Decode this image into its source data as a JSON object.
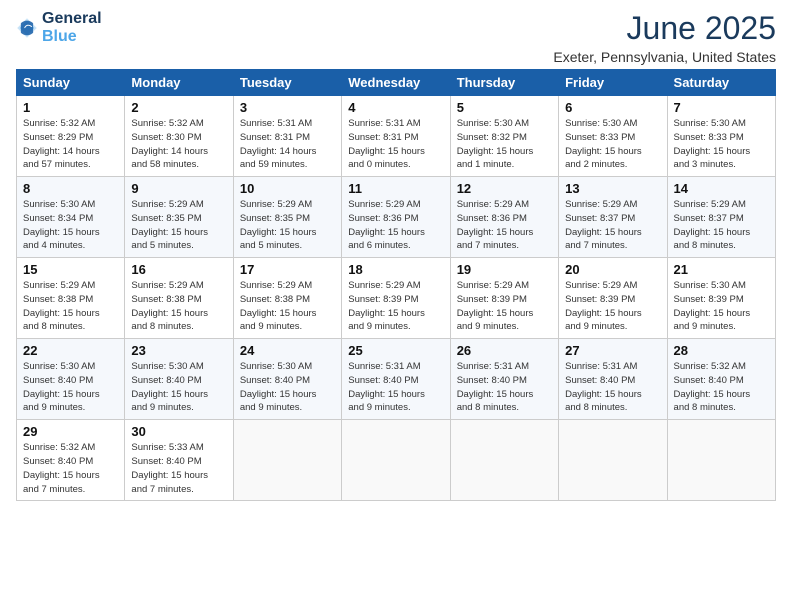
{
  "header": {
    "logo_line1": "General",
    "logo_line2": "Blue",
    "month": "June 2025",
    "location": "Exeter, Pennsylvania, United States"
  },
  "weekdays": [
    "Sunday",
    "Monday",
    "Tuesday",
    "Wednesday",
    "Thursday",
    "Friday",
    "Saturday"
  ],
  "weeks": [
    [
      {
        "day": "1",
        "info": "Sunrise: 5:32 AM\nSunset: 8:29 PM\nDaylight: 14 hours\nand 57 minutes."
      },
      {
        "day": "2",
        "info": "Sunrise: 5:32 AM\nSunset: 8:30 PM\nDaylight: 14 hours\nand 58 minutes."
      },
      {
        "day": "3",
        "info": "Sunrise: 5:31 AM\nSunset: 8:31 PM\nDaylight: 14 hours\nand 59 minutes."
      },
      {
        "day": "4",
        "info": "Sunrise: 5:31 AM\nSunset: 8:31 PM\nDaylight: 15 hours\nand 0 minutes."
      },
      {
        "day": "5",
        "info": "Sunrise: 5:30 AM\nSunset: 8:32 PM\nDaylight: 15 hours\nand 1 minute."
      },
      {
        "day": "6",
        "info": "Sunrise: 5:30 AM\nSunset: 8:33 PM\nDaylight: 15 hours\nand 2 minutes."
      },
      {
        "day": "7",
        "info": "Sunrise: 5:30 AM\nSunset: 8:33 PM\nDaylight: 15 hours\nand 3 minutes."
      }
    ],
    [
      {
        "day": "8",
        "info": "Sunrise: 5:30 AM\nSunset: 8:34 PM\nDaylight: 15 hours\nand 4 minutes."
      },
      {
        "day": "9",
        "info": "Sunrise: 5:29 AM\nSunset: 8:35 PM\nDaylight: 15 hours\nand 5 minutes."
      },
      {
        "day": "10",
        "info": "Sunrise: 5:29 AM\nSunset: 8:35 PM\nDaylight: 15 hours\nand 5 minutes."
      },
      {
        "day": "11",
        "info": "Sunrise: 5:29 AM\nSunset: 8:36 PM\nDaylight: 15 hours\nand 6 minutes."
      },
      {
        "day": "12",
        "info": "Sunrise: 5:29 AM\nSunset: 8:36 PM\nDaylight: 15 hours\nand 7 minutes."
      },
      {
        "day": "13",
        "info": "Sunrise: 5:29 AM\nSunset: 8:37 PM\nDaylight: 15 hours\nand 7 minutes."
      },
      {
        "day": "14",
        "info": "Sunrise: 5:29 AM\nSunset: 8:37 PM\nDaylight: 15 hours\nand 8 minutes."
      }
    ],
    [
      {
        "day": "15",
        "info": "Sunrise: 5:29 AM\nSunset: 8:38 PM\nDaylight: 15 hours\nand 8 minutes."
      },
      {
        "day": "16",
        "info": "Sunrise: 5:29 AM\nSunset: 8:38 PM\nDaylight: 15 hours\nand 8 minutes."
      },
      {
        "day": "17",
        "info": "Sunrise: 5:29 AM\nSunset: 8:38 PM\nDaylight: 15 hours\nand 9 minutes."
      },
      {
        "day": "18",
        "info": "Sunrise: 5:29 AM\nSunset: 8:39 PM\nDaylight: 15 hours\nand 9 minutes."
      },
      {
        "day": "19",
        "info": "Sunrise: 5:29 AM\nSunset: 8:39 PM\nDaylight: 15 hours\nand 9 minutes."
      },
      {
        "day": "20",
        "info": "Sunrise: 5:29 AM\nSunset: 8:39 PM\nDaylight: 15 hours\nand 9 minutes."
      },
      {
        "day": "21",
        "info": "Sunrise: 5:30 AM\nSunset: 8:39 PM\nDaylight: 15 hours\nand 9 minutes."
      }
    ],
    [
      {
        "day": "22",
        "info": "Sunrise: 5:30 AM\nSunset: 8:40 PM\nDaylight: 15 hours\nand 9 minutes."
      },
      {
        "day": "23",
        "info": "Sunrise: 5:30 AM\nSunset: 8:40 PM\nDaylight: 15 hours\nand 9 minutes."
      },
      {
        "day": "24",
        "info": "Sunrise: 5:30 AM\nSunset: 8:40 PM\nDaylight: 15 hours\nand 9 minutes."
      },
      {
        "day": "25",
        "info": "Sunrise: 5:31 AM\nSunset: 8:40 PM\nDaylight: 15 hours\nand 9 minutes."
      },
      {
        "day": "26",
        "info": "Sunrise: 5:31 AM\nSunset: 8:40 PM\nDaylight: 15 hours\nand 8 minutes."
      },
      {
        "day": "27",
        "info": "Sunrise: 5:31 AM\nSunset: 8:40 PM\nDaylight: 15 hours\nand 8 minutes."
      },
      {
        "day": "28",
        "info": "Sunrise: 5:32 AM\nSunset: 8:40 PM\nDaylight: 15 hours\nand 8 minutes."
      }
    ],
    [
      {
        "day": "29",
        "info": "Sunrise: 5:32 AM\nSunset: 8:40 PM\nDaylight: 15 hours\nand 7 minutes."
      },
      {
        "day": "30",
        "info": "Sunrise: 5:33 AM\nSunset: 8:40 PM\nDaylight: 15 hours\nand 7 minutes."
      },
      {
        "day": "",
        "info": ""
      },
      {
        "day": "",
        "info": ""
      },
      {
        "day": "",
        "info": ""
      },
      {
        "day": "",
        "info": ""
      },
      {
        "day": "",
        "info": ""
      }
    ]
  ]
}
